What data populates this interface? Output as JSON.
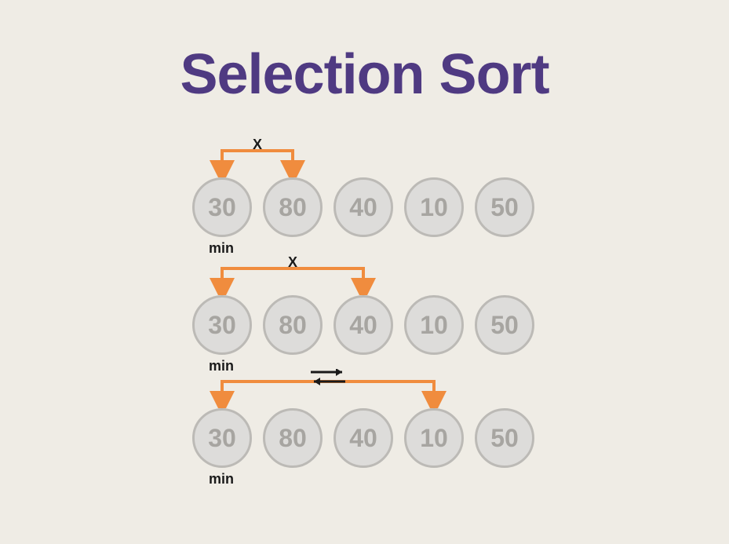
{
  "title": "Selection Sort",
  "minLabel": "min",
  "noSwapSymbol": "X",
  "stages": {
    "s1": {
      "values": [
        "30",
        "80",
        "40",
        "10",
        "50"
      ],
      "compareTarget": 1,
      "swap": false,
      "minIndex": 0
    },
    "s2": {
      "values": [
        "30",
        "80",
        "40",
        "10",
        "50"
      ],
      "compareTarget": 2,
      "swap": false,
      "minIndex": 0
    },
    "s3": {
      "values": [
        "30",
        "80",
        "40",
        "10",
        "50"
      ],
      "compareTarget": 3,
      "swap": true,
      "minIndex": 0
    }
  },
  "layout": {
    "ballPitch": 90,
    "ballRadius": 38,
    "orange": "#f08c3e",
    "black": "#1a1a1a"
  }
}
